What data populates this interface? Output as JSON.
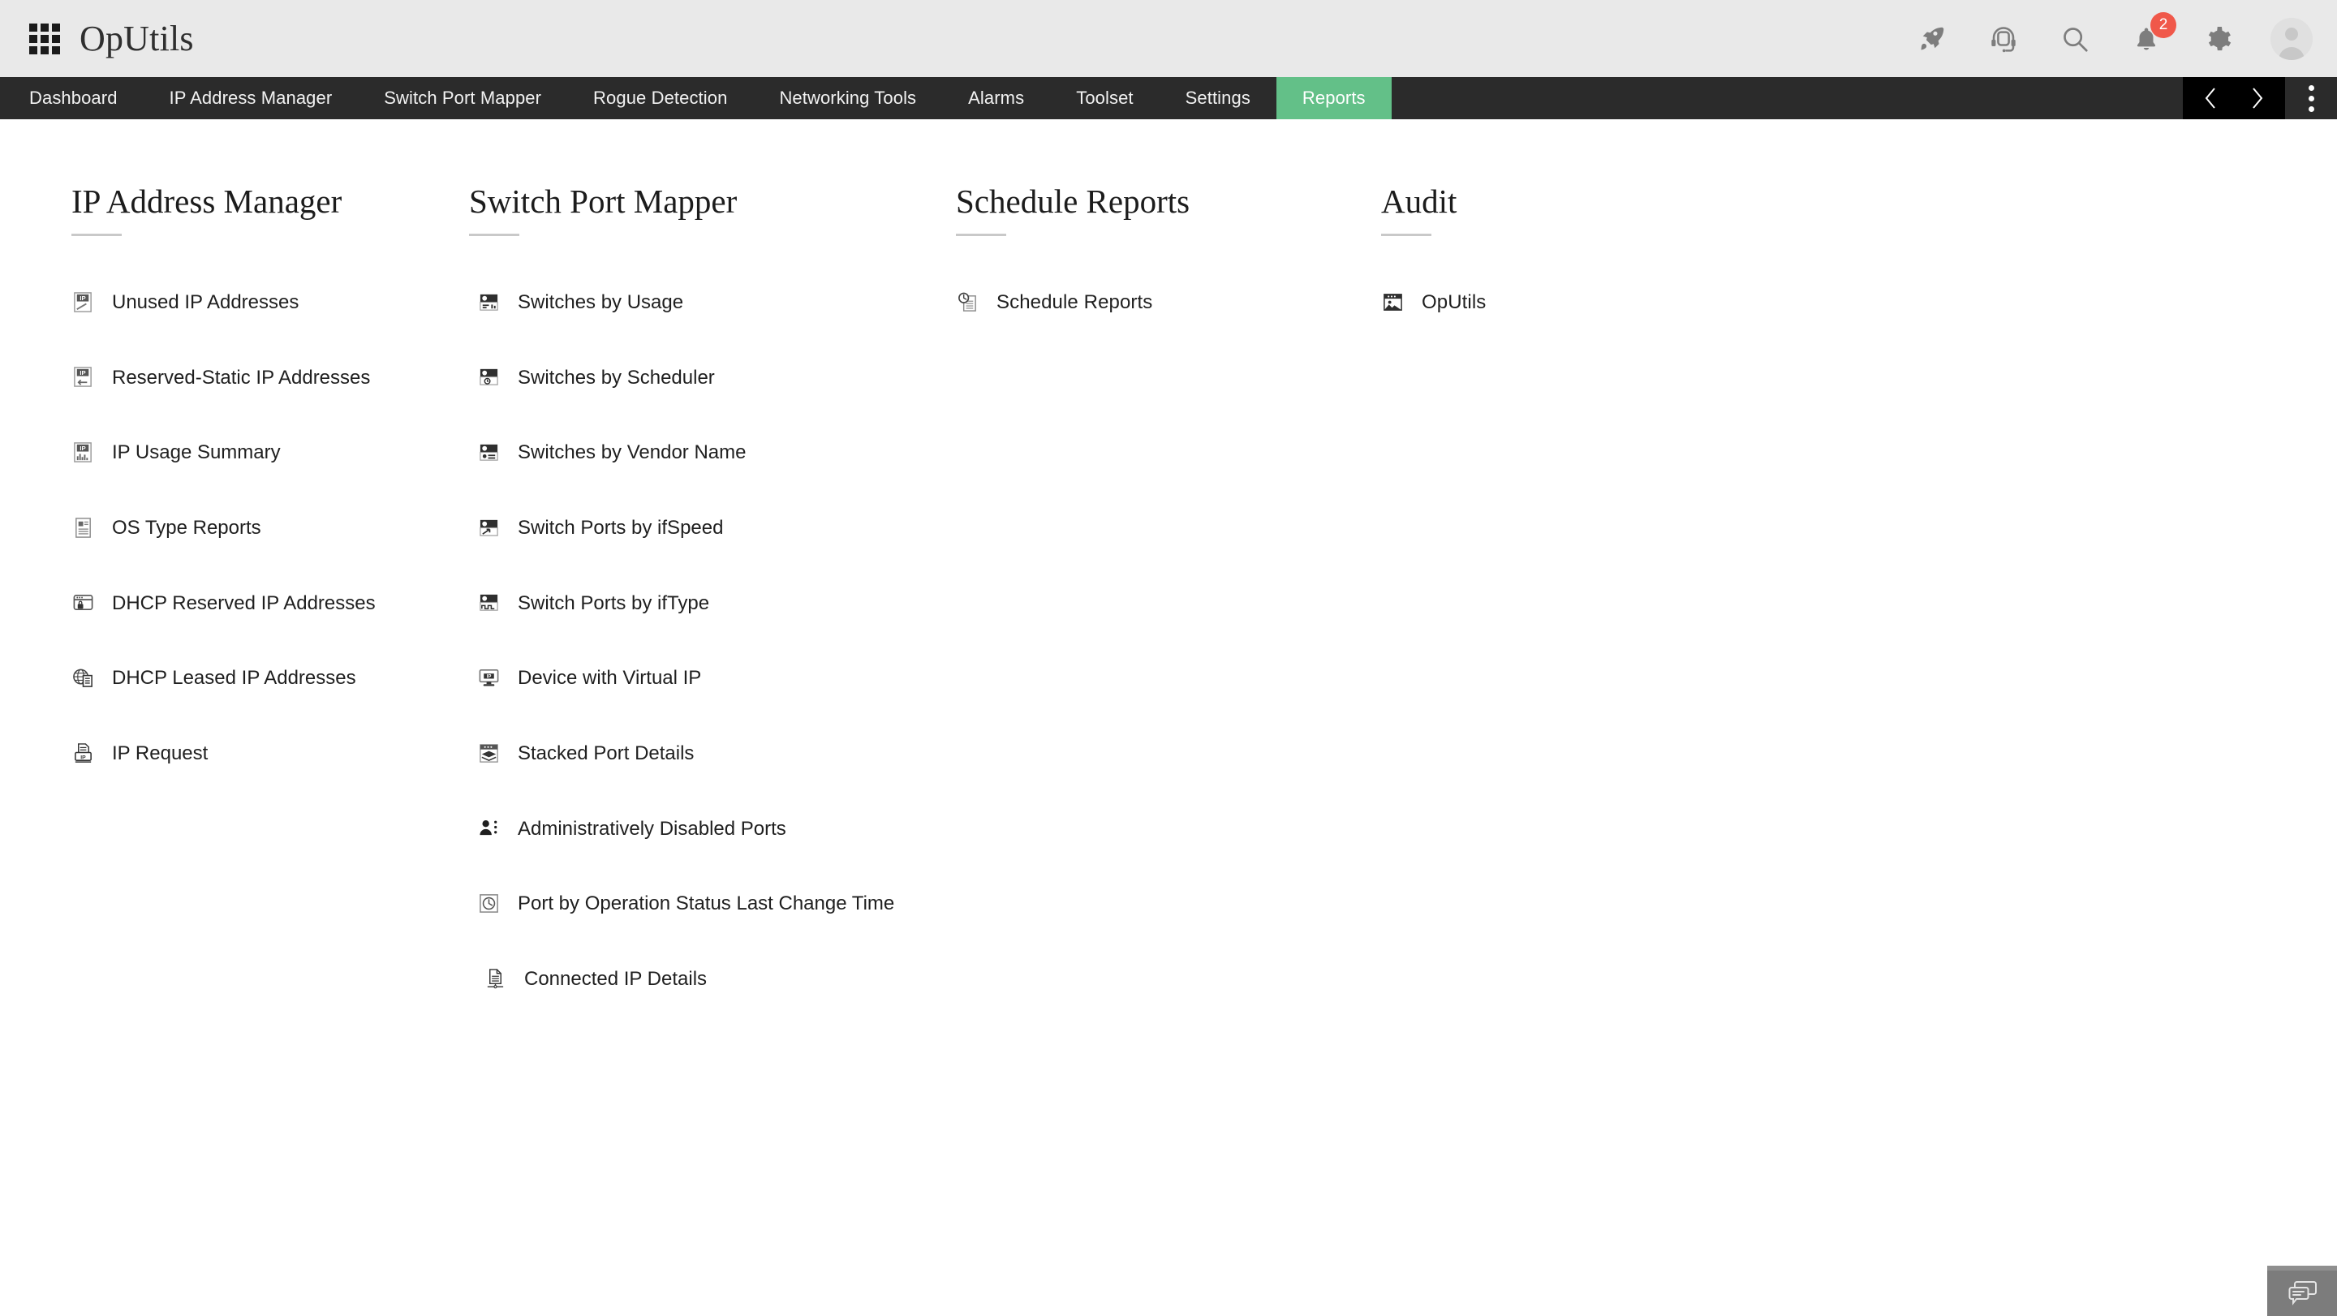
{
  "app": {
    "title": "OpUtils",
    "accent_green": "#63c088",
    "nav_bg": "#2b2b2b",
    "header_bg": "#e9e9e9",
    "badge_color": "#f0584a"
  },
  "header": {
    "apps_icon": "grid-apps-icon",
    "icons": [
      {
        "name": "rocket-icon",
        "label": "Rocket"
      },
      {
        "name": "headset-icon",
        "label": "Support"
      },
      {
        "name": "search-icon",
        "label": "Search"
      },
      {
        "name": "bell-icon",
        "label": "Notifications",
        "badge": "2"
      },
      {
        "name": "gear-icon",
        "label": "Settings"
      },
      {
        "name": "user-avatar-icon",
        "label": "Profile"
      }
    ]
  },
  "nav": {
    "items": [
      {
        "label": "Dashboard",
        "active": false
      },
      {
        "label": "IP Address Manager",
        "active": false
      },
      {
        "label": "Switch Port Mapper",
        "active": false
      },
      {
        "label": "Rogue Detection",
        "active": false
      },
      {
        "label": "Networking Tools",
        "active": false
      },
      {
        "label": "Alarms",
        "active": false
      },
      {
        "label": "Toolset",
        "active": false
      },
      {
        "label": "Settings",
        "active": false
      },
      {
        "label": "Reports",
        "active": true
      }
    ],
    "prev_label": "‹",
    "next_label": "›"
  },
  "columns": [
    {
      "title": "IP Address Manager",
      "items": [
        {
          "label": "Unused IP Addresses",
          "icon": "ip-document-slash-icon"
        },
        {
          "label": "Reserved-Static IP Addresses",
          "icon": "ip-document-arrow-icon"
        },
        {
          "label": "IP Usage Summary",
          "icon": "ip-document-chart-icon"
        },
        {
          "label": "OS Type Reports",
          "icon": "document-list-icon"
        },
        {
          "label": "DHCP Reserved IP Addresses",
          "icon": "window-lock-icon"
        },
        {
          "label": "DHCP Leased IP Addresses",
          "icon": "globe-document-icon"
        },
        {
          "label": "IP Request",
          "icon": "printer-ip-icon"
        }
      ]
    },
    {
      "title": "Switch Port Mapper",
      "items": [
        {
          "label": "Switches by Usage",
          "icon": "switch-usage-icon"
        },
        {
          "label": "Switches by Scheduler",
          "icon": "switch-clock-icon"
        },
        {
          "label": "Switches by Vendor Name",
          "icon": "switch-vendor-icon"
        },
        {
          "label": "Switch Ports by ifSpeed",
          "icon": "switch-speed-icon"
        },
        {
          "label": "Switch Ports by ifType",
          "icon": "switch-waveform-icon"
        },
        {
          "label": "Device with Virtual IP",
          "icon": "monitor-ip-icon"
        },
        {
          "label": "Stacked Port Details",
          "icon": "stacked-ports-icon"
        },
        {
          "label": "Administratively Disabled Ports",
          "icon": "user-disabled-icon"
        },
        {
          "label": "Port by Operation Status Last Change Time",
          "icon": "clock-square-icon"
        },
        {
          "label": "Connected IP Details",
          "icon": "connected-document-icon"
        }
      ]
    },
    {
      "title": "Schedule Reports",
      "items": [
        {
          "label": "Schedule Reports",
          "icon": "clock-report-icon"
        }
      ]
    },
    {
      "title": "Audit",
      "items": [
        {
          "label": "OpUtils",
          "icon": "oputils-window-icon"
        }
      ]
    }
  ],
  "chat_widget": {
    "name": "chat-support-widget",
    "label": "Chat"
  }
}
